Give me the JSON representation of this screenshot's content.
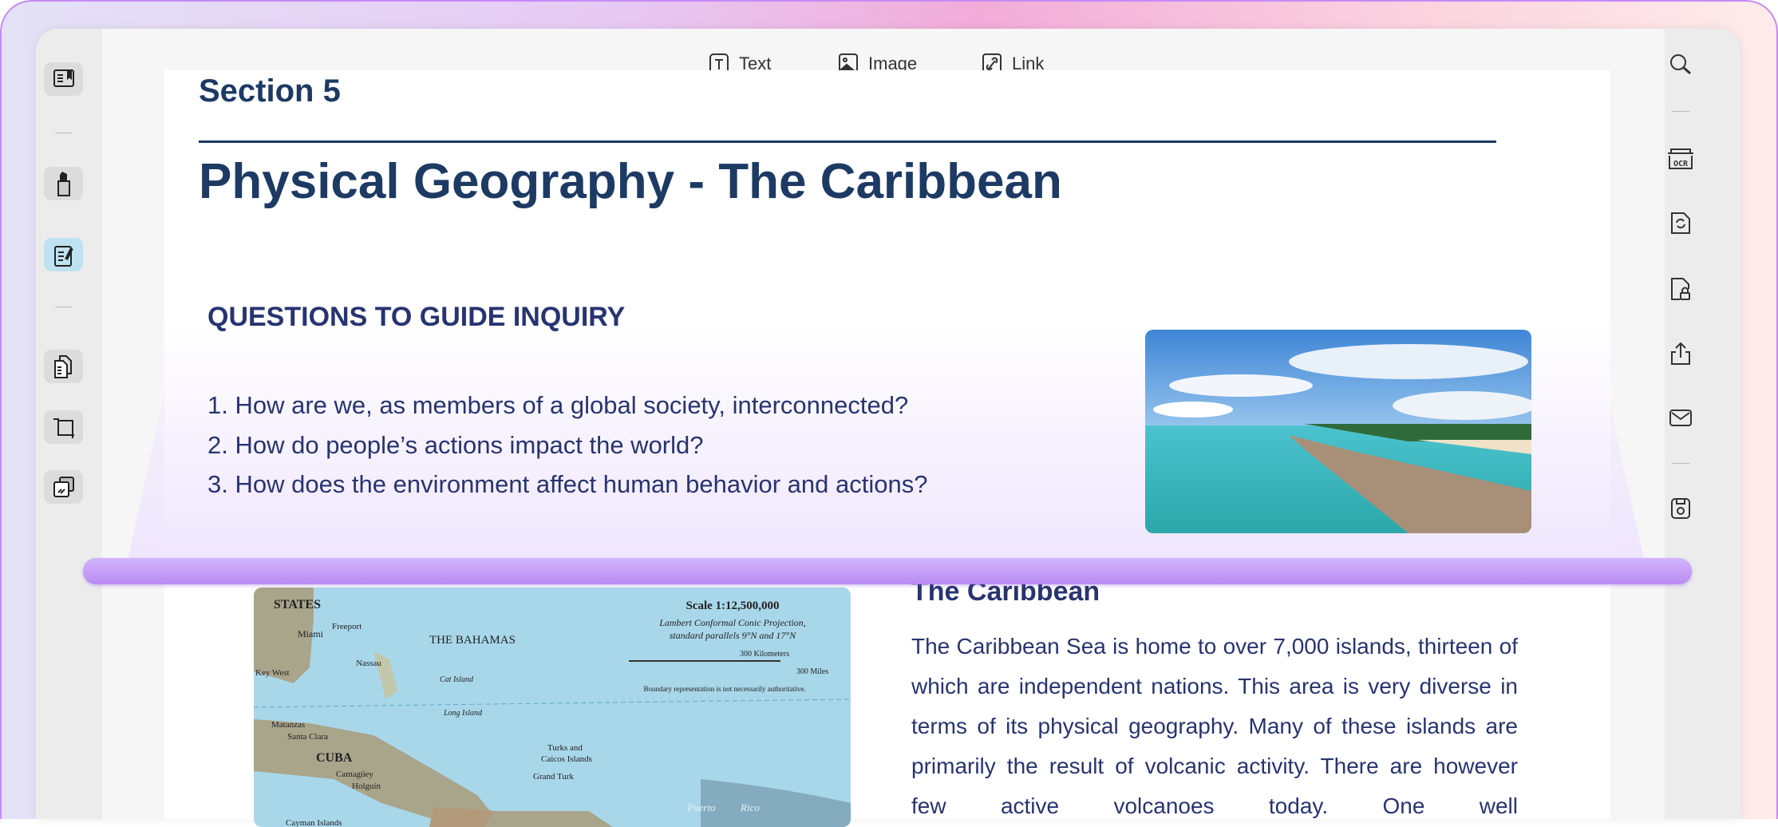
{
  "toolbar": {
    "text": "Text",
    "image": "Image",
    "link": "Link"
  },
  "left_sidebar": [
    "bookmark-reader-icon",
    "highlighter-icon",
    "edit-note-icon",
    "pages-icon",
    "crop-icon",
    "overlay-icon"
  ],
  "right_sidebar": [
    "search-icon",
    "ocr-icon",
    "convert-icon",
    "protect-icon",
    "share-icon",
    "mail-icon",
    "save-icon"
  ],
  "ocr_label": "OCR",
  "document": {
    "section": "Section 5",
    "title": "Physical Geography - The Caribbean",
    "questions_heading": "QUESTIONS TO GUIDE INQUIRY",
    "questions": [
      "1. How are we, as members of a global society, interconnected?",
      "2. How do people’s actions impact the world?",
      "3. How does the environment affect human behavior and actions?"
    ],
    "section_heading": "The Caribbean",
    "paragraph": "The Caribbean Sea is home to over 7,000 islands, thirteen of which are independent nations. This area is very diverse in terms of its physical geography. Many of these islands are primarily the result of volcanic activity. There are however few active volcanoes today. One well"
  },
  "map": {
    "scale": "Scale 1:12,500,000",
    "projection1": "Lambert Conformal Conic Projection,",
    "projection2": "standard parallels 9°N and 17°N",
    "km": "300 Kilometers",
    "miles": "300 Miles",
    "boundary": "Boundary representation is not necessarily authoritative.",
    "labels": {
      "us": "STATES",
      "miami": "Miami",
      "bahamas": "THE BAHAMAS",
      "nassau": "Nassau",
      "freeport": "Freeport",
      "keywest": "Key West",
      "cuba": "CUBA",
      "matanzas": "Matanzas",
      "santaclara": "Santa Clara",
      "camaguey": "Camagüey",
      "holguin": "Holguín",
      "turks": "Turks and",
      "caicos": "Caicos Islands",
      "grandturk": "Grand Turk",
      "puerto": "Puerto",
      "rico": "Rico",
      "cayman": "Cayman Islands",
      "catisland": "Cat Island",
      "longisland": "Long Island"
    }
  }
}
